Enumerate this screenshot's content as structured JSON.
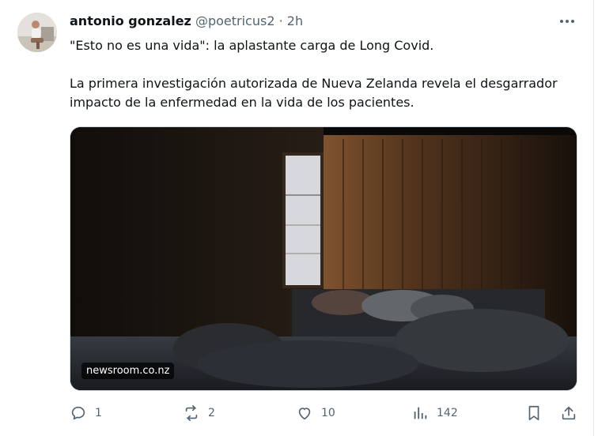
{
  "post": {
    "author": "antonio gonzalez",
    "handle": "@poetricus2",
    "separator": "·",
    "time": "2h",
    "text_line1": "\"Esto no es una vida\": la aplastante carga de Long Covid.",
    "text_line2": "La primera investigación autorizada de Nueva Zelanda revela el desgarrador impacto de la enfermedad en la vida de los pacientes.",
    "media_domain": "newsroom.co.nz"
  },
  "actions": {
    "replies": "1",
    "reposts": "2",
    "likes": "10",
    "views": "142"
  },
  "icons": {
    "more": "more-horizontal-icon",
    "reply": "reply-icon",
    "repost": "repost-icon",
    "like": "like-icon",
    "views": "views-icon",
    "bookmark": "bookmark-icon",
    "share": "share-icon"
  },
  "colors": {
    "text": "#0f1419",
    "muted": "#536471",
    "border": "#cfd9de"
  }
}
